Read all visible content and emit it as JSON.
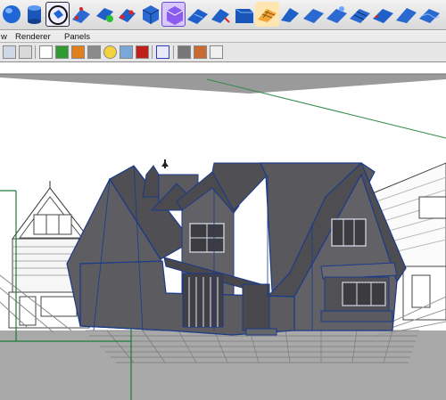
{
  "menubar": {
    "items": [
      "w",
      "Renderer",
      "Panels"
    ]
  },
  "shelf": {
    "icons": [
      "polygon-sphere-icon",
      "polygon-cylinder-icon",
      "select-tool-icon",
      "split-polygon-icon",
      "extrude-face-icon",
      "merge-vertex-icon",
      "cube-component-icon",
      "purple-cube-icon",
      "plane-icon",
      "wedge-icon",
      "bevel-icon",
      "grid-plane-icon",
      "append-polygon-icon",
      "flat-plane-icon",
      "soft-plane-icon",
      "checker-plane-icon",
      "tilted-plane-icon",
      "slope-plane-icon",
      "wave-plane-icon"
    ]
  },
  "toolbar": {
    "icons": [
      "grid-toggle-icon",
      "film-gate-icon",
      "wireframe-icon",
      "shaded-icon",
      "textured-icon",
      "light-icon",
      "default-light-icon",
      "smooth-shade-icon",
      "isolate-icon",
      "bounding-box-icon",
      "resolution-gate-icon",
      "camera-icon",
      "xray-icon",
      "joint-icon"
    ]
  },
  "viewport": {
    "label": "perspective-viewport"
  },
  "colors": {
    "accent": "#1a3a8a",
    "shelf_blue": "#1e5fc8",
    "model_gray": "#5c5c60",
    "floor": "#a9a9a9"
  }
}
